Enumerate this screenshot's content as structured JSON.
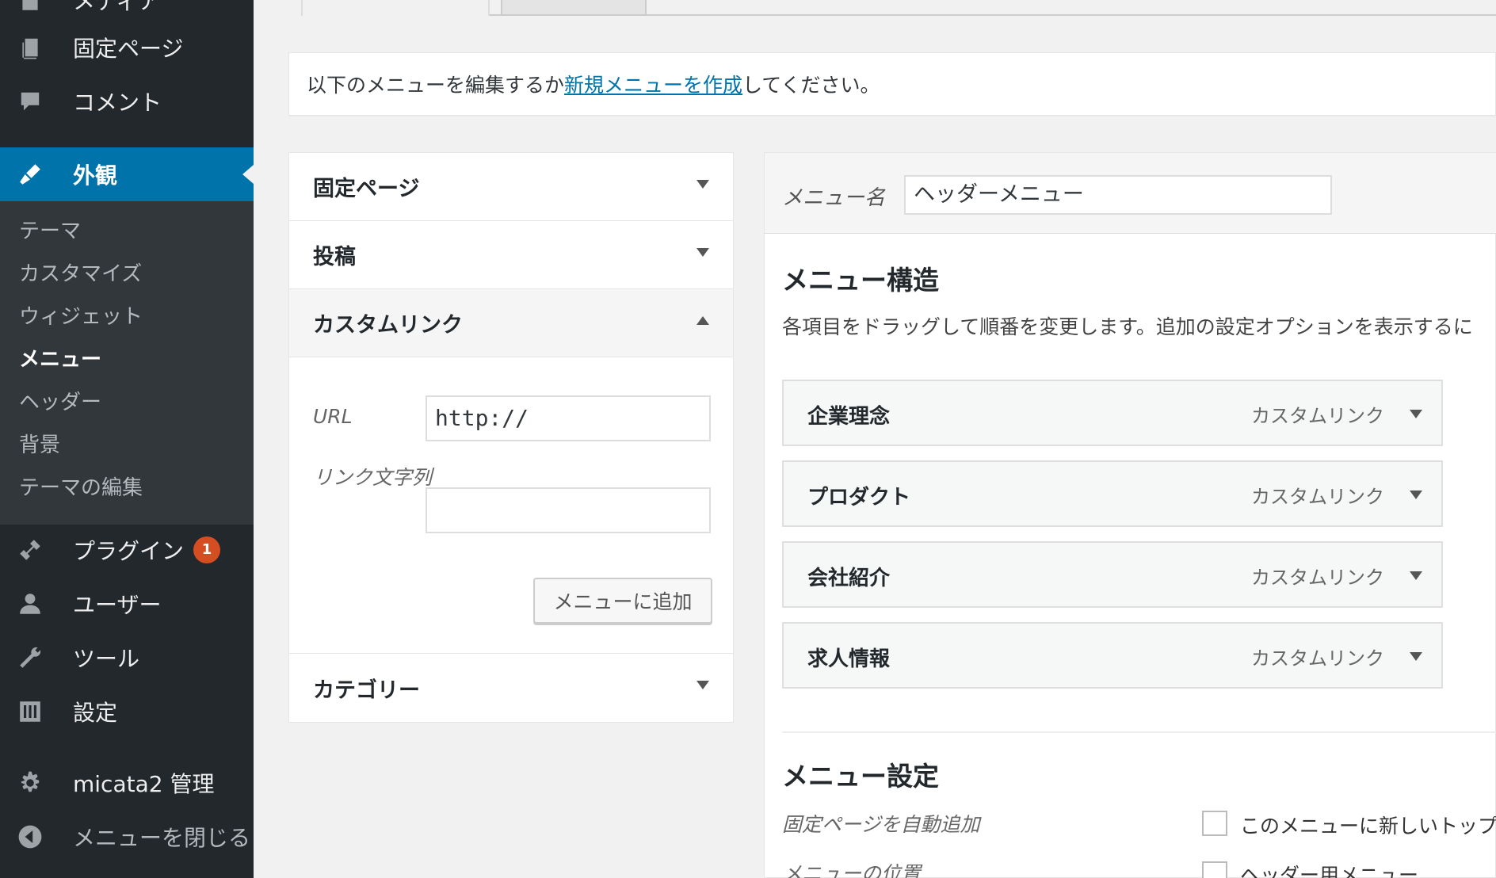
{
  "sidebar": {
    "items": [
      {
        "label": "メディア",
        "icon": "media-icon"
      },
      {
        "label": "固定ページ",
        "icon": "page-icon"
      },
      {
        "label": "コメント",
        "icon": "comment-icon"
      },
      {
        "label": "外観",
        "icon": "appearance-icon"
      },
      {
        "label": "プラグイン",
        "icon": "plugin-icon",
        "badge": "1"
      },
      {
        "label": "ユーザー",
        "icon": "user-icon"
      },
      {
        "label": "ツール",
        "icon": "tool-icon"
      },
      {
        "label": "設定",
        "icon": "settings-icon"
      },
      {
        "label": "micata2 管理",
        "icon": "gear-icon"
      },
      {
        "label": "メニューを閉じる",
        "icon": "collapse-icon"
      }
    ],
    "submenu": [
      "テーマ",
      "カスタマイズ",
      "ウィジェット",
      "メニュー",
      "ヘッダー",
      "背景",
      "テーマの編集"
    ]
  },
  "notice": {
    "before": "以下のメニューを編集するか",
    "link": "新規メニューを作成",
    "after": "してください。"
  },
  "accordion": {
    "sections": [
      "固定ページ",
      "投稿",
      "カスタムリンク",
      "カテゴリー"
    ],
    "url_label": "URL",
    "url_value": "http://",
    "link_text_label": "リンク文字列",
    "link_text_value": "",
    "add_button": "メニューに追加"
  },
  "menu_editor": {
    "name_label": "メニュー名",
    "name_value": "ヘッダーメニュー",
    "structure_title": "メニュー構造",
    "structure_desc": "各項目をドラッグして順番を変更します。追加の設定オプションを表示するに",
    "items": [
      {
        "title": "企業理念",
        "type": "カスタムリンク"
      },
      {
        "title": "プロダクト",
        "type": "カスタムリンク"
      },
      {
        "title": "会社紹介",
        "type": "カスタムリンク"
      },
      {
        "title": "求人情報",
        "type": "カスタムリンク"
      }
    ],
    "settings_title": "メニュー設定",
    "auto_add_label": "固定ページを自動追加",
    "auto_add_option": "このメニューに新しいトップ",
    "location_label": "メニューの位置",
    "location_option": "ヘッダー用メニュー"
  },
  "colors": {
    "sidebar": "#23282d",
    "active": "#0073aa",
    "badge": "#d54e21"
  }
}
